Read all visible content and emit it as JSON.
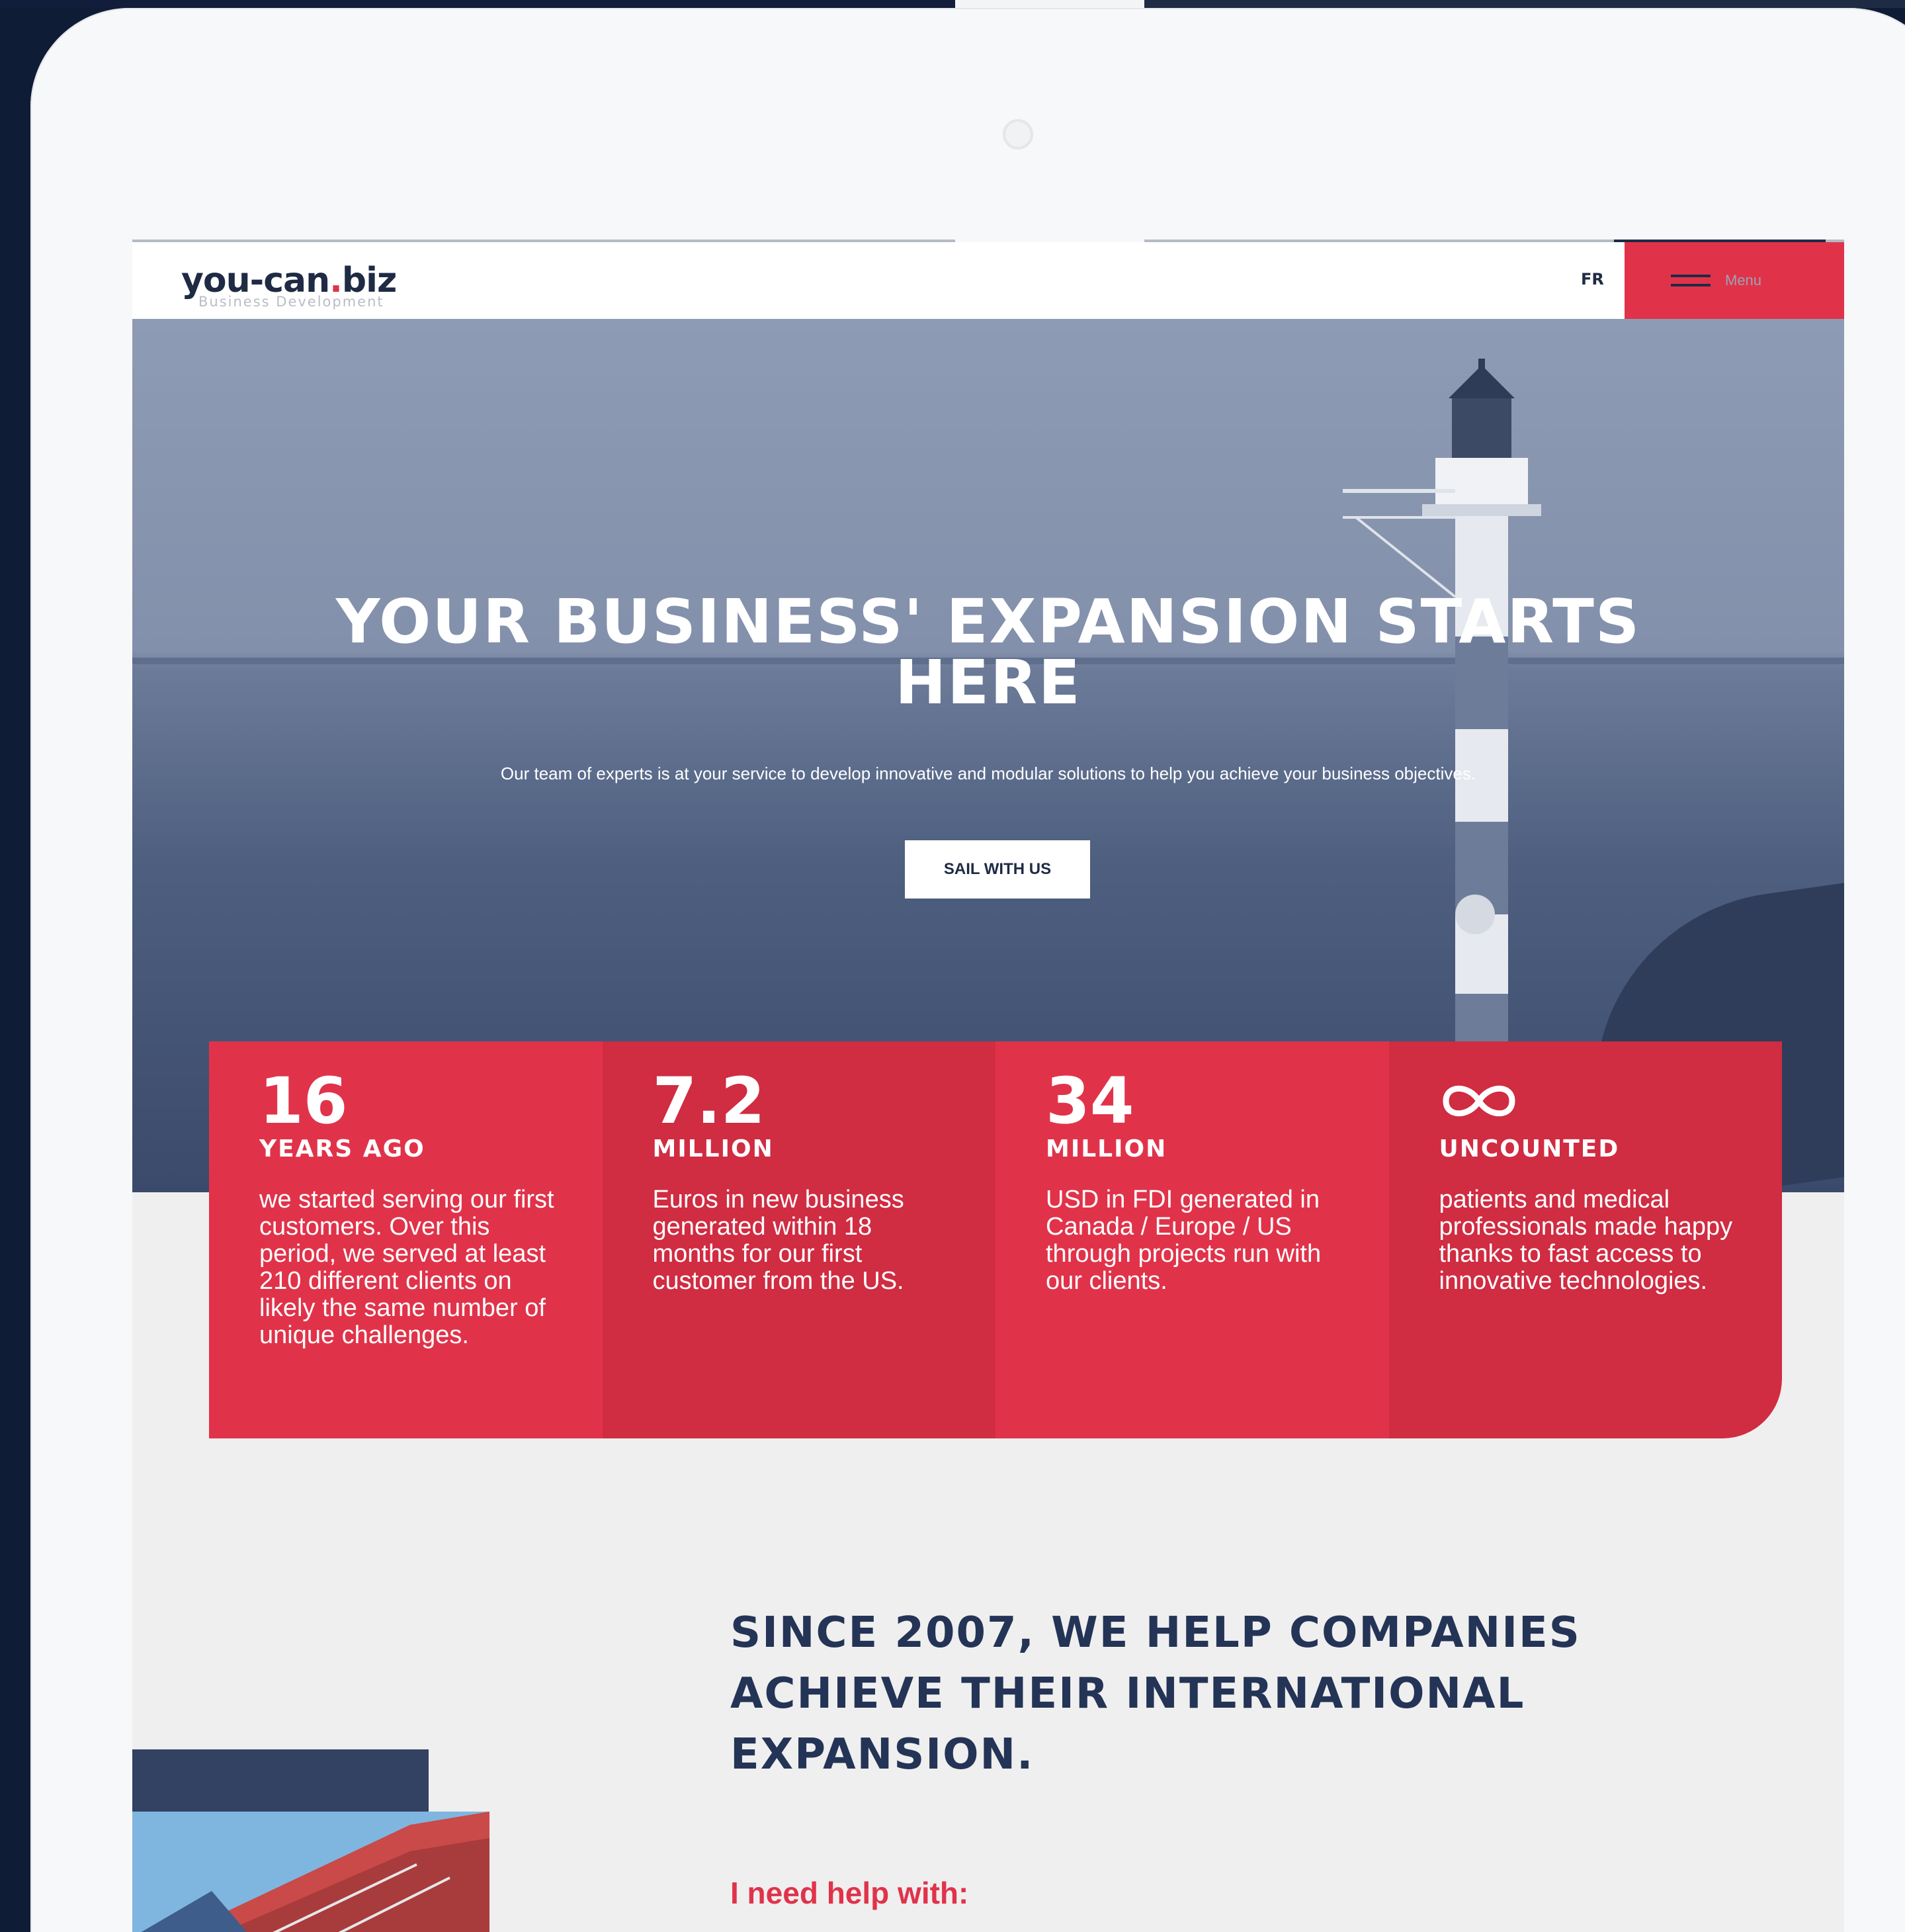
{
  "header": {
    "logo_main": "you-can",
    "logo_dot": ".",
    "logo_tld": "biz",
    "logo_sub": "Business Development",
    "lang": "FR",
    "menu_label": "Menu"
  },
  "hero": {
    "title_line1": "YOUR BUSINESS' EXPANSION STARTS",
    "title_line2": "HERE",
    "subtitle": "Our team of experts is at your service to develop innovative and modular solutions to help you achieve your business objectives.",
    "cta": "SAIL WITH US"
  },
  "stats": [
    {
      "number": "16",
      "unit": "YEARS AGO",
      "text": "we started serving our first customers. Over this period, we served at least 210 different clients on likely the same number of unique challenges."
    },
    {
      "number": "7.2",
      "unit": "MILLION",
      "text": "Euros in new business generated within 18 months for our first customer from the US."
    },
    {
      "number": "34",
      "unit": "MILLION",
      "text": "USD in FDI generated in Canada / Europe / US through projects run with our clients."
    },
    {
      "number": "",
      "unit": "UNCOUNTED",
      "text": "patients and medical professionals made happy thanks to fast access to innovative technologies."
    }
  ],
  "icons": {
    "infinity": "infinity-icon",
    "menu": "hamburger-icon"
  },
  "section": {
    "title": "SINCE 2007, WE HELP COMPANIES ACHIEVE THEIR INTERNATIONAL EXPANSION.",
    "help_label": "I need help with:"
  },
  "colors": {
    "accent": "#e0334a",
    "navy": "#243456"
  }
}
